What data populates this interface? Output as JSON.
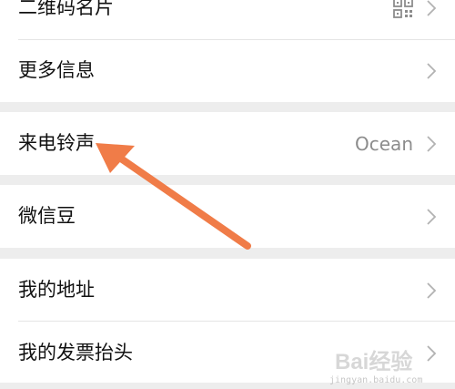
{
  "settings": {
    "group1": [
      {
        "label": "二维码名片",
        "icon": "qr-code-icon"
      },
      {
        "label": "更多信息"
      }
    ],
    "group2": [
      {
        "label": "来电铃声",
        "value": "Ocean"
      }
    ],
    "group3": [
      {
        "label": "微信豆"
      }
    ],
    "group4": [
      {
        "label": "我的地址"
      },
      {
        "label": "我的发票抬头"
      }
    ]
  },
  "annotation": {
    "arrow_color": "#f07c48"
  },
  "watermark": {
    "logo_text": "Bai经验",
    "url": "jingyan.baidu.com"
  }
}
